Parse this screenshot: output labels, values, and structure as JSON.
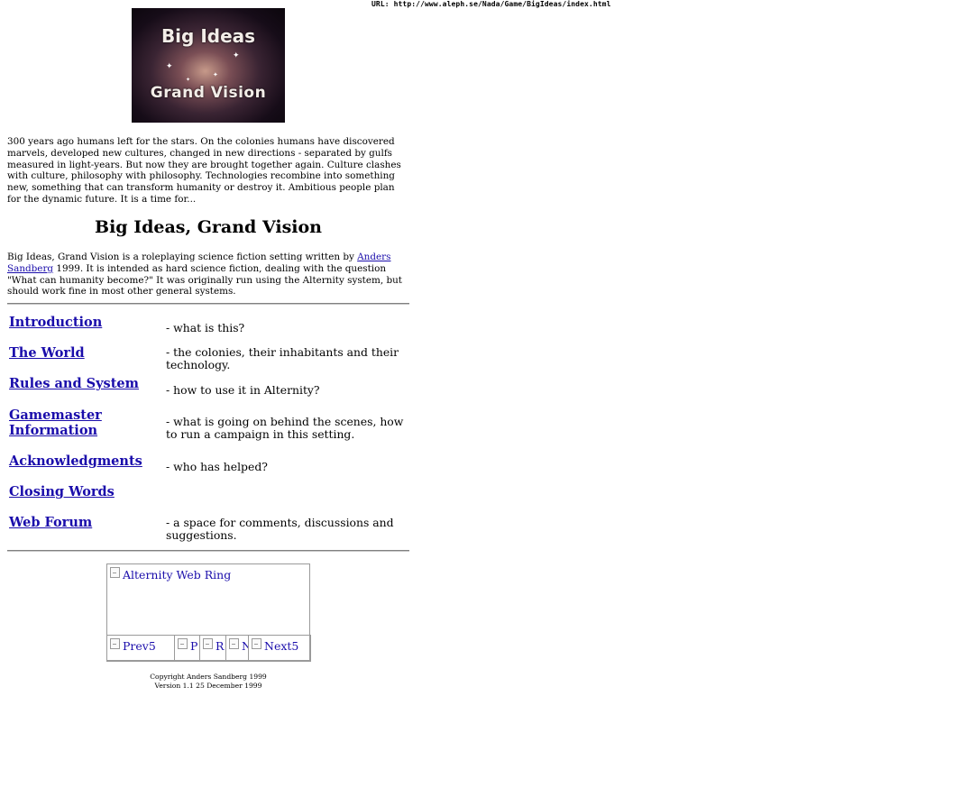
{
  "url_line": {
    "label": "URL:",
    "value": "http://www.aleph.se/Nada/Game/BigIdeas/index.html"
  },
  "banner": {
    "line1": "Big Ideas",
    "line2": "Grand Vision"
  },
  "intro_text": "300 years ago humans left for the stars. On the colonies humans have discovered marvels, developed new cultures, changed in new directions - separated by gulfs measured in light-years. But now they are brought together again. Culture clashes with culture, philosophy with philosophy. Technologies recombine into something new, something that can transform humanity or destroy it. Ambitious people plan for the dynamic future. It is a time for...",
  "page_title": "Big Ideas, Grand Vision",
  "description": {
    "before_link": "Big Ideas, Grand Vision is a roleplaying science fiction setting written by ",
    "author_link": "Anders Sandberg",
    "after_link": " 1999. It is intended as hard science fiction, dealing with the question \"What can humanity become?\" It was originally run using the Alternity system, but should work fine in most other general systems."
  },
  "toc": [
    {
      "label": "Introduction",
      "desc": "- what is this?"
    },
    {
      "label": "The World",
      "desc": "- the colonies, their inhabitants and their technology."
    },
    {
      "label": "Rules and System",
      "desc": "- how to use it in Alternity?"
    },
    {
      "label": "Gamemaster Information",
      "desc": "- what is going on behind the scenes, how to run a campaign in this setting."
    },
    {
      "label": "Acknowledgments",
      "desc": "- who has helped?"
    },
    {
      "label": "Closing Words",
      "desc": ""
    },
    {
      "label": "Web Forum",
      "desc": "- a space for comments, discussions and suggestions."
    }
  ],
  "webring": {
    "title": "Alternity Web Ring",
    "prev5": "Prev5",
    "prev": "P",
    "random": "R",
    "next": "N",
    "next5": "Next5"
  },
  "footer": {
    "copyright": "Copyright Anders Sandberg 1999",
    "version": "Version 1.1 25 December 1999"
  }
}
